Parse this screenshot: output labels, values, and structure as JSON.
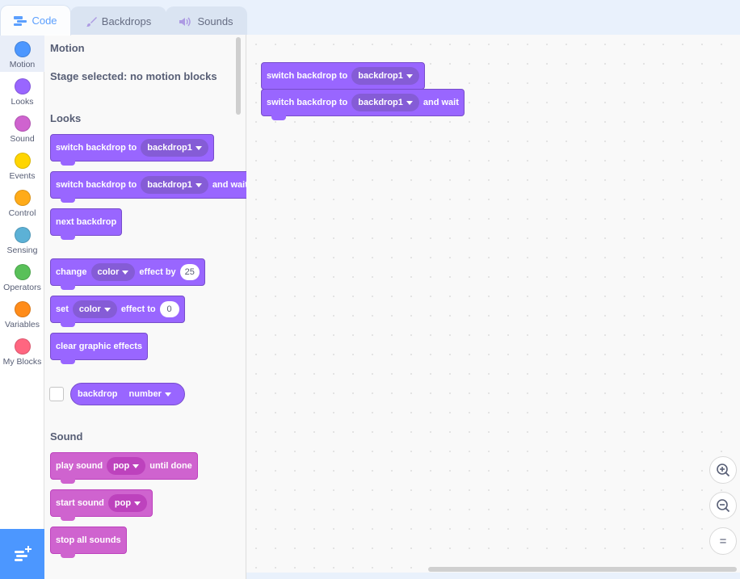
{
  "tabs": {
    "code": "Code",
    "backdrops": "Backdrops",
    "sounds": "Sounds"
  },
  "categories": [
    {
      "label": "Motion",
      "color": "#4c97ff"
    },
    {
      "label": "Looks",
      "color": "#9966ff"
    },
    {
      "label": "Sound",
      "color": "#cf63cf"
    },
    {
      "label": "Events",
      "color": "#ffd500"
    },
    {
      "label": "Control",
      "color": "#ffab19"
    },
    {
      "label": "Sensing",
      "color": "#5cb1d6"
    },
    {
      "label": "Operators",
      "color": "#59c059"
    },
    {
      "label": "Variables",
      "color": "#ff8c1a"
    },
    {
      "label": "My Blocks",
      "color": "#ff6680"
    }
  ],
  "palette": {
    "motion_title": "Motion",
    "motion_note": "Stage selected: no motion blocks",
    "looks_title": "Looks",
    "sound_title": "Sound",
    "looks_blocks": {
      "switch_backdrop": {
        "text": "switch backdrop to",
        "value": "backdrop1"
      },
      "switch_backdrop_wait": {
        "text": "switch backdrop to",
        "value": "backdrop1",
        "suffix": "and wait"
      },
      "next_backdrop": "next backdrop",
      "change_effect": {
        "prefix": "change",
        "value": "color",
        "middle": "effect by",
        "amount": "25"
      },
      "set_effect": {
        "prefix": "set",
        "value": "color",
        "middle": "effect to",
        "amount": "0"
      },
      "clear_effects": "clear graphic effects",
      "backdrop_reporter": {
        "text": "backdrop",
        "value": "number"
      }
    },
    "sound_blocks": {
      "play_sound": {
        "prefix": "play sound",
        "value": "pop",
        "suffix": "until done"
      },
      "start_sound": {
        "prefix": "start sound",
        "value": "pop"
      },
      "stop_all": "stop all sounds"
    }
  },
  "workspace": {
    "block1": {
      "text": "switch backdrop to",
      "value": "backdrop1"
    },
    "block2": {
      "text": "switch backdrop to",
      "value": "backdrop1",
      "suffix": "and wait"
    }
  },
  "zoom": {
    "zoom_in": "zoom-in-icon",
    "zoom_out": "zoom-out-icon",
    "reset": "="
  }
}
